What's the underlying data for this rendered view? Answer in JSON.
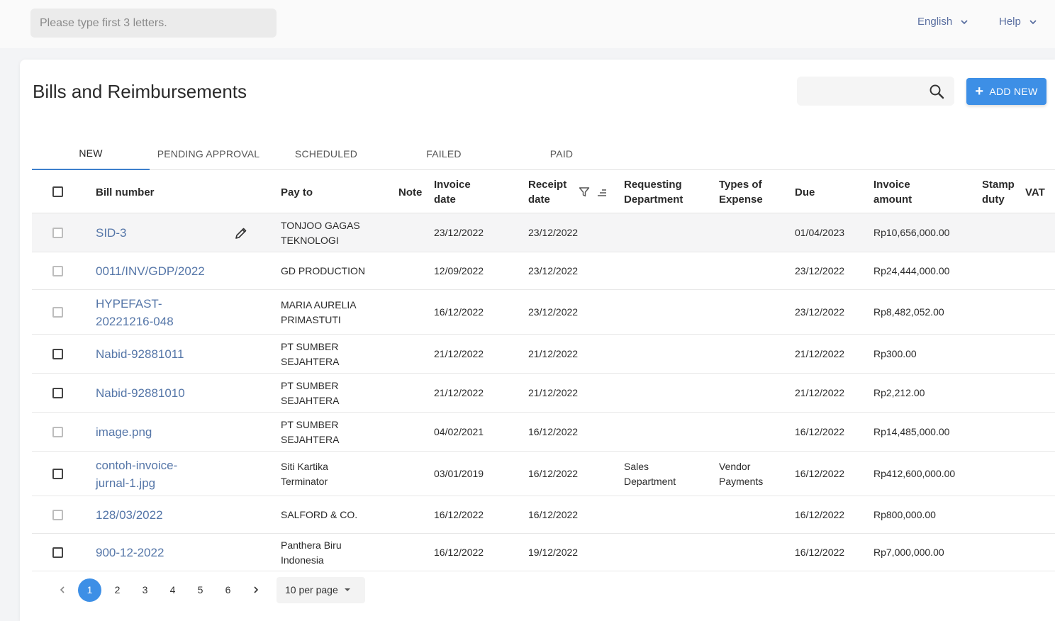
{
  "topbar": {
    "search_placeholder": "Please type first 3 letters.",
    "language_label": "English",
    "help_label": "Help"
  },
  "page": {
    "title": "Bills and Reimbursements",
    "add_new_label": "ADD NEW"
  },
  "tabs": [
    {
      "label": "NEW",
      "active": true
    },
    {
      "label": "PENDING APPROVAL",
      "active": false
    },
    {
      "label": "SCHEDULED",
      "active": false
    },
    {
      "label": "FAILED",
      "active": false
    },
    {
      "label": "PAID",
      "active": false
    }
  ],
  "columns": {
    "bill_number": "Bill number",
    "pay_to": "Pay to",
    "note": "Note",
    "invoice_date": [
      "Invoice",
      "date"
    ],
    "receipt_date": [
      "Receipt",
      "date"
    ],
    "requesting_department": [
      "Requesting",
      "Department"
    ],
    "types_of_expense": [
      "Types of",
      "Expense"
    ],
    "due": "Due",
    "invoice_amount": [
      "Invoice",
      "amount"
    ],
    "stamp_duty": [
      "Stamp",
      "duty"
    ],
    "vat": "VAT"
  },
  "rows": [
    {
      "bill": [
        "SID-3"
      ],
      "pay_to": [
        "TONJOO GAGAS",
        "TEKNOLOGI"
      ],
      "invoice_date": "23/12/2022",
      "receipt_date": "23/12/2022",
      "department": [],
      "expense": [],
      "due": "01/04/2023",
      "amount": "Rp10,656,000.00"
    },
    {
      "bill": [
        "0011/INV/GDP/2022"
      ],
      "pay_to": [
        "GD PRODUCTION"
      ],
      "invoice_date": "12/09/2022",
      "receipt_date": "23/12/2022",
      "department": [],
      "expense": [],
      "due": "23/12/2022",
      "amount": "Rp24,444,000.00"
    },
    {
      "bill": [
        "HYPEFAST-",
        "20221216-048"
      ],
      "pay_to": [
        "MARIA AURELIA",
        "PRIMASTUTI"
      ],
      "invoice_date": "16/12/2022",
      "receipt_date": "23/12/2022",
      "department": [],
      "expense": [],
      "due": "23/12/2022",
      "amount": "Rp8,482,052.00"
    },
    {
      "bill": [
        "Nabid-92881011"
      ],
      "pay_to": [
        "PT SUMBER",
        "SEJAHTERA"
      ],
      "invoice_date": "21/12/2022",
      "receipt_date": "21/12/2022",
      "department": [],
      "expense": [],
      "due": "21/12/2022",
      "amount": "Rp300.00"
    },
    {
      "bill": [
        "Nabid-92881010"
      ],
      "pay_to": [
        "PT SUMBER",
        "SEJAHTERA"
      ],
      "invoice_date": "21/12/2022",
      "receipt_date": "21/12/2022",
      "department": [],
      "expense": [],
      "due": "21/12/2022",
      "amount": "Rp2,212.00"
    },
    {
      "bill": [
        "image.png"
      ],
      "pay_to": [
        "PT SUMBER",
        "SEJAHTERA"
      ],
      "invoice_date": "04/02/2021",
      "receipt_date": "16/12/2022",
      "department": [],
      "expense": [],
      "due": "16/12/2022",
      "amount": "Rp14,485,000.00"
    },
    {
      "bill": [
        "contoh-invoice-",
        "jurnal-1.jpg"
      ],
      "pay_to": [
        "Siti Kartika",
        "Terminator"
      ],
      "invoice_date": "03/01/2019",
      "receipt_date": "16/12/2022",
      "department": [
        "Sales",
        "Department"
      ],
      "expense": [
        "Vendor",
        "Payments"
      ],
      "due": "16/12/2022",
      "amount": "Rp412,600,000.00"
    },
    {
      "bill": [
        "128/03/2022"
      ],
      "pay_to": [
        "SALFORD & CO."
      ],
      "invoice_date": "16/12/2022",
      "receipt_date": "16/12/2022",
      "department": [],
      "expense": [],
      "due": "16/12/2022",
      "amount": "Rp800,000.00"
    },
    {
      "bill": [
        "900-12-2022"
      ],
      "pay_to": [
        "Panthera Biru",
        "Indonesia"
      ],
      "invoice_date": "16/12/2022",
      "receipt_date": "19/12/2022",
      "department": [],
      "expense": [],
      "due": "16/12/2022",
      "amount": "Rp7,000,000.00"
    }
  ],
  "pagination": {
    "pages": [
      "1",
      "2",
      "3",
      "4",
      "5",
      "6"
    ],
    "current": "1",
    "per_page_label": "10 per page"
  },
  "colors": {
    "accent": "#3d8fe6",
    "link": "#5576a8"
  }
}
